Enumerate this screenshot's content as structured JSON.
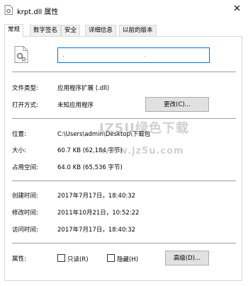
{
  "window": {
    "title": "krpt.dll 属性",
    "close": "✕"
  },
  "tabs": [
    "常规",
    "数字签名",
    "安全",
    "详细信息",
    "以前的版本"
  ],
  "file": {
    "name": ".            .            ."
  },
  "rows": {
    "type": {
      "label": "文件类型:",
      "value": "应用程序扩展 (.dll)"
    },
    "opens_with": {
      "label": "打开方式:",
      "value": "未知应用程序",
      "button": "更改(C)..."
    },
    "location": {
      "label": "位置:",
      "value": "C:\\Users\\admin\\Desktop\\下载包"
    },
    "size": {
      "label": "大小:",
      "value": "60.7 KB (62,184 字节)"
    },
    "size_on_disk": {
      "label": "占用空间:",
      "value": "64.0 KB (65,536 字节)"
    },
    "created": {
      "label": "创建时间:",
      "value": "2017年7月17日，18:40:32"
    },
    "modified": {
      "label": "修改时间:",
      "value": "2011年10月21日，10:52:22"
    },
    "accessed": {
      "label": "访问时间:",
      "value": "2017年7月17日，18:40:32"
    }
  },
  "attributes": {
    "label": "属性:",
    "readonly": "只读(R)",
    "hidden": "隐藏(H)",
    "advanced": "高级(D)..."
  },
  "watermark": {
    "line1": "JZ5U绿色下载",
    "line2": "www.jz5u.com"
  }
}
